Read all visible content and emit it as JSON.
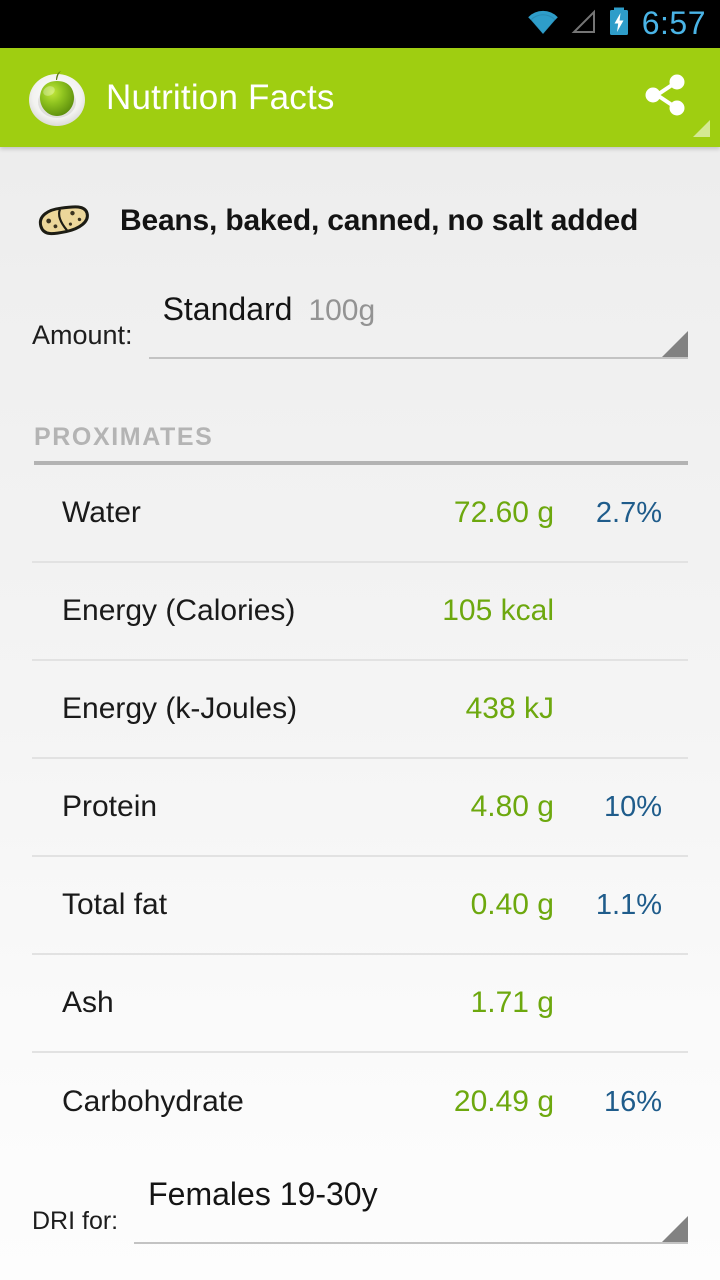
{
  "status_bar": {
    "time": "6:57",
    "icons": [
      "wifi-icon",
      "cellular-signal-icon",
      "battery-charging-icon"
    ],
    "clock_color": "#4ab4e6",
    "background": "#000000"
  },
  "action_bar": {
    "title": "Nutrition Facts",
    "logo_icon": "apple-logo-icon",
    "share_icon": "share-icon",
    "overflow_icon": "overflow-triangle-icon",
    "background": "#9fce11",
    "title_color": "#ffffff"
  },
  "food": {
    "name": "Beans, baked, canned, no salt added",
    "icon": "beans-food-icon"
  },
  "amount": {
    "label": "Amount:",
    "value": "Standard",
    "sub_value": "100g",
    "spinner_icon": "spinner-triangle-icon"
  },
  "section": {
    "title": "PROXIMATES",
    "title_color": "#b4b4b4"
  },
  "nutrients": [
    {
      "label": "Water",
      "value": "72.60 g",
      "pct": "2.7%"
    },
    {
      "label": "Energy (Calories)",
      "value": "105 kcal",
      "pct": ""
    },
    {
      "label": "Energy (k-Joules)",
      "value": "438 kJ",
      "pct": ""
    },
    {
      "label": "Protein",
      "value": "4.80 g",
      "pct": "10%"
    },
    {
      "label": "Total fat",
      "value": "0.40 g",
      "pct": "1.1%"
    },
    {
      "label": "Ash",
      "value": "1.71 g",
      "pct": ""
    },
    {
      "label": "Carbohydrate",
      "value": "20.49 g",
      "pct": "16%"
    }
  ],
  "dri": {
    "label": "DRI for:",
    "value": "Females 19-30y",
    "spinner_icon": "spinner-triangle-icon"
  },
  "colors": {
    "accent_green": "#9fce11",
    "value_green": "#6da80e",
    "pct_blue": "#1f5c8b",
    "label_black": "#1a1a1a",
    "muted_gray": "#939393",
    "divider_gray": "#e2e2e2"
  }
}
